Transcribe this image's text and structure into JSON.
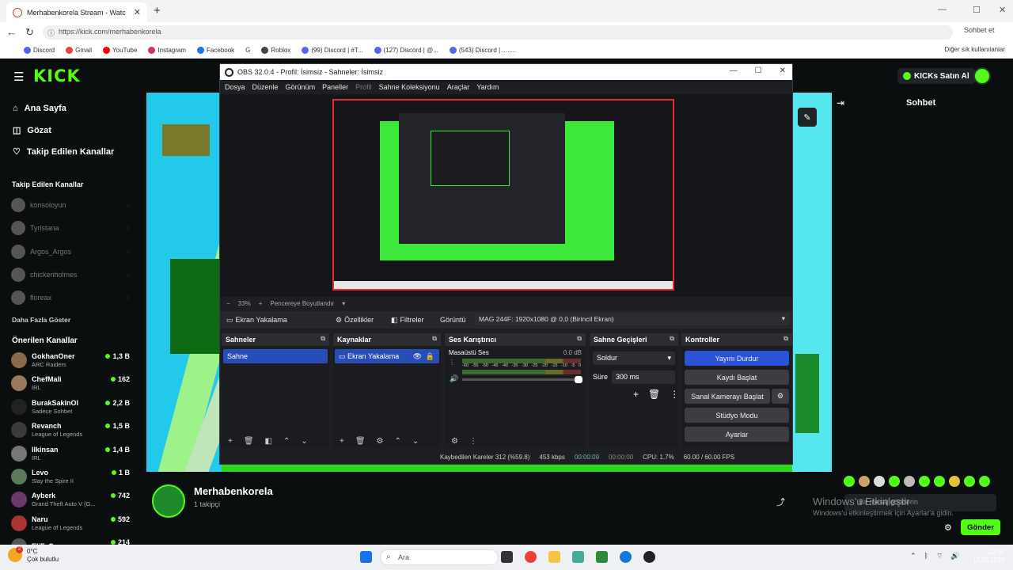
{
  "browser": {
    "tab_title": "Merhabakenkorela Stream - Watc",
    "tab_title_full": "Merhabenkorela Stream - Watc",
    "url": "https://kick.com/merhabenkorela",
    "bookmarks": [
      "Discord",
      "Gmail",
      "YouTube",
      "Instagram",
      "Facebook",
      "G",
      "Roblox",
      "(99) Discord | #T...",
      "(127) Discord | @...",
      "(543) Discord | ........"
    ],
    "other_bookmarks": "Diğer sık kullanılanlar",
    "chat_button": "Sohbet et"
  },
  "kick": {
    "logo": "KICK",
    "logo_sup": "BETA",
    "buy_kicks": "KICKs Satın Al",
    "nav": [
      "Ana Sayfa",
      "Gözat",
      "Takip Edilen Kanallar"
    ],
    "followed_title": "Takip Edilen Kanallar",
    "followed": [
      "konsoloyun",
      "Tyristana",
      "Argos_Argos",
      "chickenholmes",
      "floreax"
    ],
    "show_more": "Daha Fazla Göster",
    "recommended_title": "Önerilen Kanallar",
    "recommended": [
      {
        "name": "GokhanOner",
        "cat": "ARC Raiders",
        "viewers": "1,3 B",
        "color": "#8a6a4a"
      },
      {
        "name": "ChefMali",
        "cat": "IRL",
        "viewers": "162",
        "color": "#9a7a5a"
      },
      {
        "name": "BurakSakinOl",
        "cat": "Sadece Sohbet",
        "viewers": "2,2 B",
        "color": "#222"
      },
      {
        "name": "Revanch",
        "cat": "League of Legends",
        "viewers": "1,5 B",
        "color": "#3a3a3a"
      },
      {
        "name": "Ilkinsan",
        "cat": "IRL",
        "viewers": "1,4 B",
        "color": "#777"
      },
      {
        "name": "Levo",
        "cat": "Slay the Spire II",
        "viewers": "1 B",
        "color": "#5a7a5a"
      },
      {
        "name": "Ayberk",
        "cat": "Grand Theft Auto V (G...",
        "viewers": "742",
        "color": "#6a3a6a"
      },
      {
        "name": "Naru",
        "cat": "League of Legends",
        "viewers": "592",
        "color": "#a33"
      },
      {
        "name": "EliFeS",
        "cat": "",
        "viewers": "214",
        "color": "#555"
      }
    ],
    "chat_title": "Sohbet",
    "channel_name": "Merhabenkorela",
    "followers": "1 takipçi",
    "chat_placeholder": "Bir mesaj gönderin",
    "send": "Gönder"
  },
  "watermark": {
    "line1": "Windows'u Etkinleştir",
    "line2": "Windows'u etkinleştirmek için Ayarlar'a gidin."
  },
  "obs": {
    "title": "OBS 32.0.4 - Profil: İsimsiz - Sahneler: İsimsiz",
    "menu": [
      "Dosya",
      "Düzenle",
      "Görünüm",
      "Paneller",
      "Profil",
      "Sahne Koleksiyonu",
      "Araçlar",
      "Yardım"
    ],
    "zoom": "33%",
    "fit": "Pencereye Boyutlandır",
    "source_name": "Ekran Yakalama",
    "properties": "Özellikler",
    "filters": "Filtreler",
    "display_label": "Görüntü",
    "display_value": "MAG 244F: 1920x1080 @ 0,0 (Birincil Ekran)",
    "docks": {
      "scenes": "Sahneler",
      "sources": "Kaynaklar",
      "mixer": "Ses Karıştırıcı",
      "transitions": "Sahne Geçişleri",
      "controls": "Kontroller"
    },
    "scene": "Sahne",
    "source": "Ekran Yakalama",
    "mixer_track": "Masaüstü Ses",
    "mixer_db": "0.0 dB",
    "meter_ticks": [
      "-60",
      "-55",
      "-50",
      "-45",
      "-40",
      "-35",
      "-30",
      "-25",
      "-20",
      "-15",
      "-10",
      "-5",
      "0"
    ],
    "transition": "Soldur",
    "duration_label": "Süre",
    "duration": "300 ms",
    "controls": [
      "Yayını Durdur",
      "Kaydı Başlat",
      "Sanal Kamerayı Başlat",
      "Stüdyo Modu",
      "Ayarlar"
    ],
    "status": {
      "dropped": "Kaybedilen Kareler 312 (%59.8)",
      "bitrate": "453 kbps",
      "stream_time": "00:00:09",
      "rec_time": "00:00:00",
      "cpu": "CPU: 1.7%",
      "fps": "60.00 / 60.00 FPS"
    }
  },
  "taskbar": {
    "temp": "0°C",
    "weather": "Çok bulutlu",
    "search": "Ara",
    "time": "12:55",
    "date": "12.03.2026"
  }
}
